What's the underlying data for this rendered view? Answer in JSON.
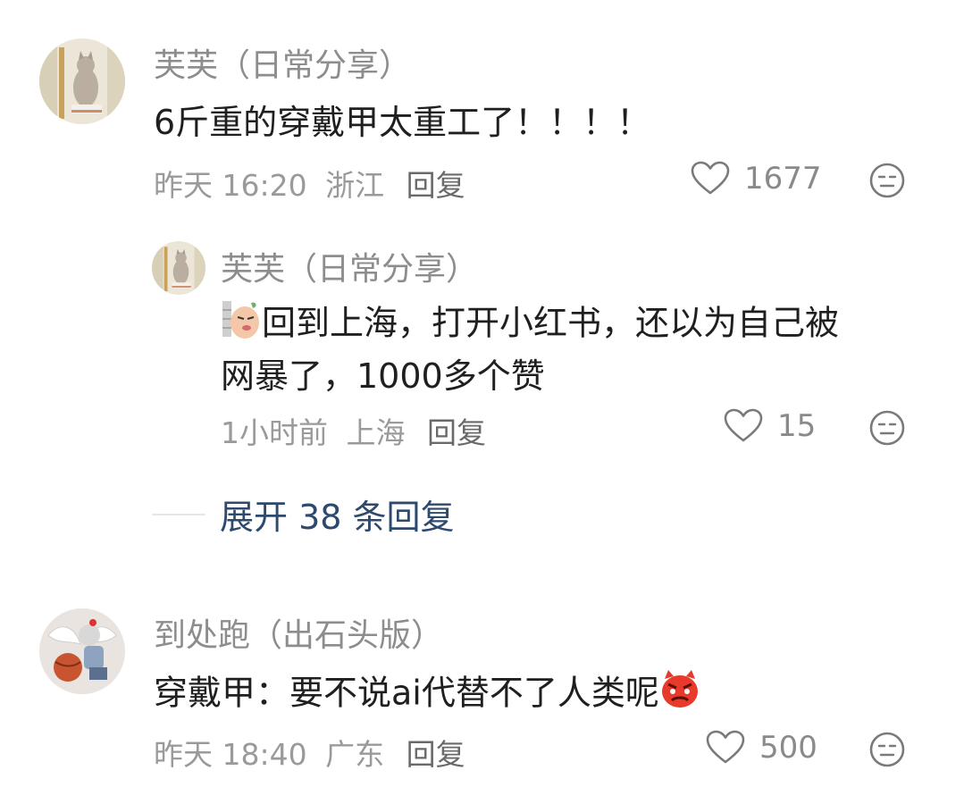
{
  "comments": [
    {
      "author": "芙芙（日常分享）",
      "text": "6斤重的穿戴甲太重工了！！！！",
      "date": "昨天 16:20",
      "location": "浙江",
      "reply_label": "回复",
      "likes": "1677",
      "avatar_icon": "cat-statue-avatar"
    },
    {
      "author": "到处跑（出石头版）",
      "text": "穿戴甲：要不说ai代替不了人类呢",
      "date": "昨天 18:40",
      "location": "广东",
      "reply_label": "回复",
      "likes": "500",
      "avatar_icon": "winged-figure-avatar",
      "trailing_emoji": "angry-red-face-emoji"
    }
  ],
  "reply": {
    "author": "芙芙（日常分享）",
    "line1": "回到上海，打开小红书，还以为自己被",
    "line2": "网暴了，1000多个赞",
    "date": "1小时前",
    "location": "上海",
    "reply_label": "回复",
    "likes": "15",
    "leading_emoji": "peeking-face-emoji"
  },
  "expand_label": "展开 38 条回复",
  "colors": {
    "name": "#8d8d8d",
    "text": "#1f1f1f",
    "meta": "#9a9a9a",
    "expand": "#2d4a6e"
  }
}
